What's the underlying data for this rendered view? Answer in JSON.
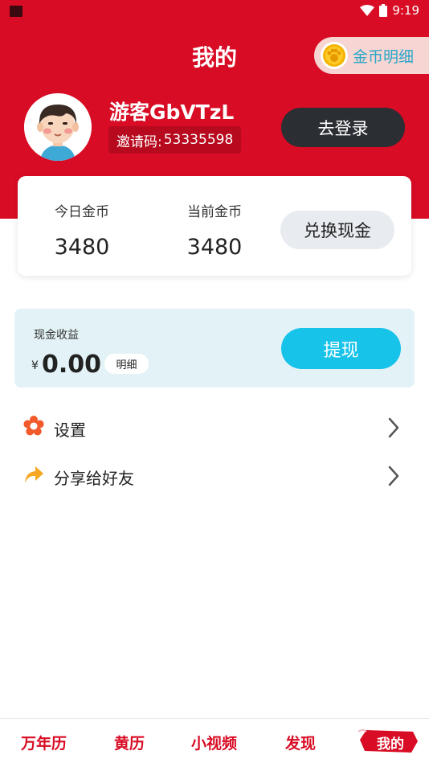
{
  "status_bar": {
    "time": "9:19"
  },
  "header": {
    "title": "我的",
    "coin_detail_label": "金币明细"
  },
  "profile": {
    "username": "游客GbVTzL",
    "invite_label": "邀请码:",
    "invite_code": "53335598",
    "login_label": "去登录"
  },
  "coins": {
    "today_label": "今日金币",
    "today_value": "3480",
    "current_label": "当前金币",
    "current_value": "3480",
    "exchange_label": "兑换现金"
  },
  "cash": {
    "label": "现金收益",
    "currency": "¥",
    "amount": "0.00",
    "detail_label": "明细",
    "withdraw_label": "提现"
  },
  "menu": {
    "items": [
      {
        "label": "设置",
        "icon": "settings-flower-icon"
      },
      {
        "label": "分享给好友",
        "icon": "share-arrow-icon"
      }
    ]
  },
  "tabbar": {
    "items": [
      {
        "label": "万年历"
      },
      {
        "label": "黄历"
      },
      {
        "label": "小视频"
      },
      {
        "label": "发现"
      },
      {
        "label": "我的",
        "active": true
      }
    ]
  },
  "colors": {
    "brand_red": "#d80c24",
    "cyan_button": "#18c3ea",
    "dark_button": "#2b2e33",
    "cash_card_bg": "#e2f2f6"
  }
}
